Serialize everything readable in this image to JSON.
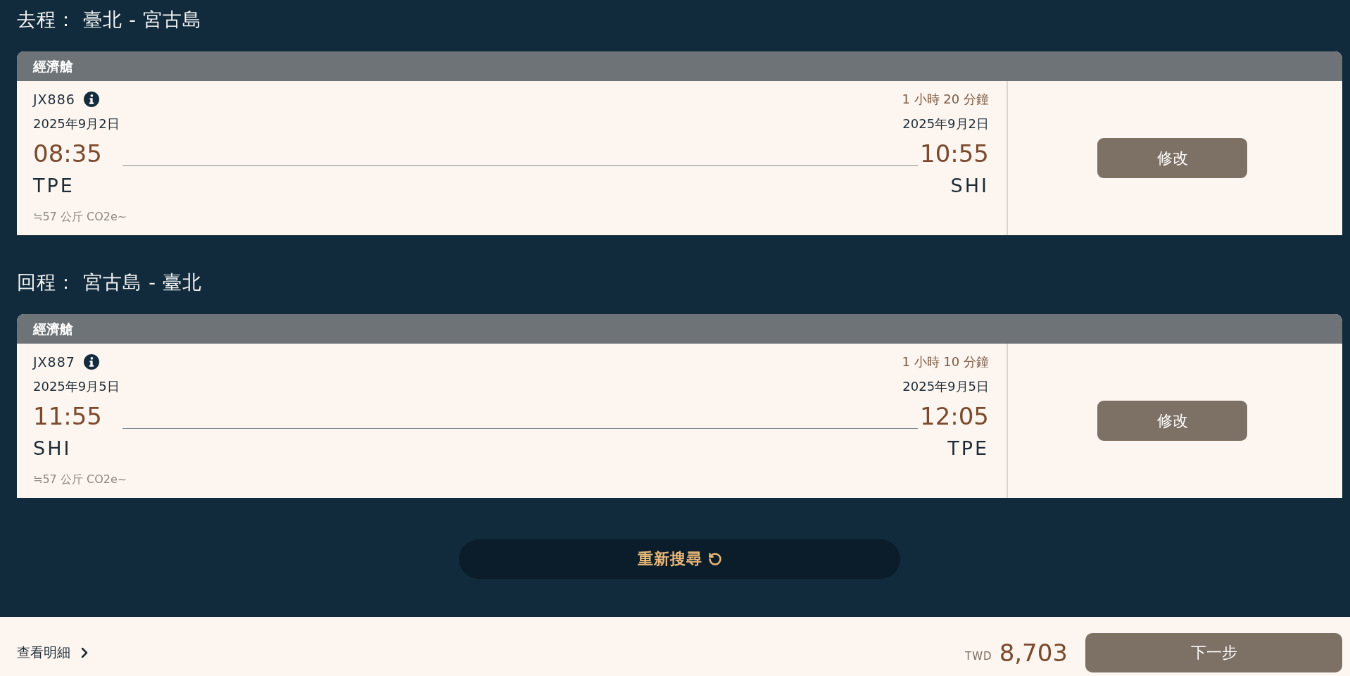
{
  "segments": [
    {
      "heading": "去程： 臺北 - 宮古島",
      "cabin": "經濟艙",
      "flight_number": "JX886",
      "duration": "1 小時 20 分鐘",
      "departure": {
        "date": "2025年9月2日",
        "time": "08:35",
        "airport": "TPE"
      },
      "arrival": {
        "date": "2025年9月2日",
        "time": "10:55",
        "airport": "SHI"
      },
      "emissions": "≒57 公斤 CO2e~",
      "action_button": "修改"
    },
    {
      "heading": "回程： 宮古島 - 臺北",
      "cabin": "經濟艙",
      "flight_number": "JX887",
      "duration": "1 小時 10 分鐘",
      "departure": {
        "date": "2025年9月5日",
        "time": "11:55",
        "airport": "SHI"
      },
      "arrival": {
        "date": "2025年9月5日",
        "time": "12:05",
        "airport": "TPE"
      },
      "emissions": "≒57 公斤 CO2e~",
      "action_button": "修改"
    }
  ],
  "search_again_button": "重新搜尋",
  "footer": {
    "details_link": "查看明細",
    "currency": "TWD",
    "total": "8,703",
    "next_button": "下一步"
  }
}
